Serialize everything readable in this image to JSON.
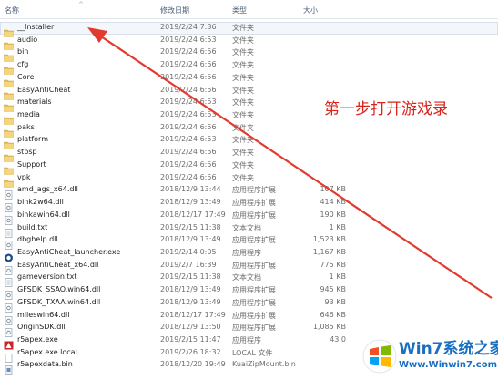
{
  "columns": {
    "name": "名称",
    "date": "修改日期",
    "type": "类型",
    "size": "大小"
  },
  "rows": [
    {
      "name": "__Installer",
      "date": "2019/2/24 7:36",
      "type": "文件夹",
      "size": "",
      "icon": "folder-icon"
    },
    {
      "name": "audio",
      "date": "2019/2/24 6:53",
      "type": "文件夹",
      "size": "",
      "icon": "folder-icon"
    },
    {
      "name": "bin",
      "date": "2019/2/24 6:56",
      "type": "文件夹",
      "size": "",
      "icon": "folder-icon"
    },
    {
      "name": "cfg",
      "date": "2019/2/24 6:56",
      "type": "文件夹",
      "size": "",
      "icon": "folder-icon"
    },
    {
      "name": "Core",
      "date": "2019/2/24 6:56",
      "type": "文件夹",
      "size": "",
      "icon": "folder-icon"
    },
    {
      "name": "EasyAntiCheat",
      "date": "2019/2/24 6:56",
      "type": "文件夹",
      "size": "",
      "icon": "folder-icon"
    },
    {
      "name": "materials",
      "date": "2019/2/24 6:53",
      "type": "文件夹",
      "size": "",
      "icon": "folder-icon"
    },
    {
      "name": "media",
      "date": "2019/2/24 6:53",
      "type": "文件夹",
      "size": "",
      "icon": "folder-icon"
    },
    {
      "name": "paks",
      "date": "2019/2/24 6:56",
      "type": "文件夹",
      "size": "",
      "icon": "folder-icon"
    },
    {
      "name": "platform",
      "date": "2019/2/24 6:53",
      "type": "文件夹",
      "size": "",
      "icon": "folder-icon"
    },
    {
      "name": "stbsp",
      "date": "2019/2/24 6:56",
      "type": "文件夹",
      "size": "",
      "icon": "folder-icon"
    },
    {
      "name": "Support",
      "date": "2019/2/24 6:56",
      "type": "文件夹",
      "size": "",
      "icon": "folder-icon"
    },
    {
      "name": "vpk",
      "date": "2019/2/24 6:56",
      "type": "文件夹",
      "size": "",
      "icon": "folder-icon"
    },
    {
      "name": "amd_ags_x64.dll",
      "date": "2018/12/9 13:44",
      "type": "应用程序扩展",
      "size": "107 KB",
      "icon": "dll-file-icon"
    },
    {
      "name": "bink2w64.dll",
      "date": "2018/12/9 13:49",
      "type": "应用程序扩展",
      "size": "414 KB",
      "icon": "dll-file-icon"
    },
    {
      "name": "binkawin64.dll",
      "date": "2018/12/17 17:49",
      "type": "应用程序扩展",
      "size": "190 KB",
      "icon": "dll-file-icon"
    },
    {
      "name": "build.txt",
      "date": "2019/2/15 11:38",
      "type": "文本文档",
      "size": "1 KB",
      "icon": "text-file-icon"
    },
    {
      "name": "dbghelp.dll",
      "date": "2018/12/9 13:49",
      "type": "应用程序扩展",
      "size": "1,523 KB",
      "icon": "dll-file-icon"
    },
    {
      "name": "EasyAntiCheat_launcher.exe",
      "date": "2019/2/14 0:05",
      "type": "应用程序",
      "size": "1,167 KB",
      "icon": "eac-app-icon"
    },
    {
      "name": "EasyAntiCheat_x64.dll",
      "date": "2019/2/7 16:39",
      "type": "应用程序扩展",
      "size": "775 KB",
      "icon": "dll-file-icon"
    },
    {
      "name": "gameversion.txt",
      "date": "2019/2/15 11:38",
      "type": "文本文档",
      "size": "1 KB",
      "icon": "text-file-icon"
    },
    {
      "name": "GFSDK_SSAO.win64.dll",
      "date": "2018/12/9 13:49",
      "type": "应用程序扩展",
      "size": "945 KB",
      "icon": "dll-file-icon"
    },
    {
      "name": "GFSDK_TXAA.win64.dll",
      "date": "2018/12/9 13:49",
      "type": "应用程序扩展",
      "size": "93 KB",
      "icon": "dll-file-icon"
    },
    {
      "name": "mileswin64.dll",
      "date": "2018/12/17 17:49",
      "type": "应用程序扩展",
      "size": "646 KB",
      "icon": "dll-file-icon"
    },
    {
      "name": "OriginSDK.dll",
      "date": "2018/12/9 13:50",
      "type": "应用程序扩展",
      "size": "1,085 KB",
      "icon": "dll-file-icon"
    },
    {
      "name": "r5apex.exe",
      "date": "2019/2/15 11:47",
      "type": "应用程序",
      "size": "43,0",
      "icon": "apex-app-icon"
    },
    {
      "name": "r5apex.exe.local",
      "date": "2019/2/26 18:32",
      "type": "LOCAL 文件",
      "size": "",
      "icon": "blank-file-icon"
    },
    {
      "name": "r5apexdata.bin",
      "date": "2018/12/20 19:49",
      "type": "KuaiZipMount.bin",
      "size": "",
      "icon": "bin-file-icon"
    }
  ],
  "annotation": {
    "text": "第一步打开游戏录",
    "color": "#d9231b"
  },
  "watermark": {
    "brand": "Win7系统之家",
    "url": "Www.Winwin7.com",
    "color": "#1b6fc1"
  }
}
